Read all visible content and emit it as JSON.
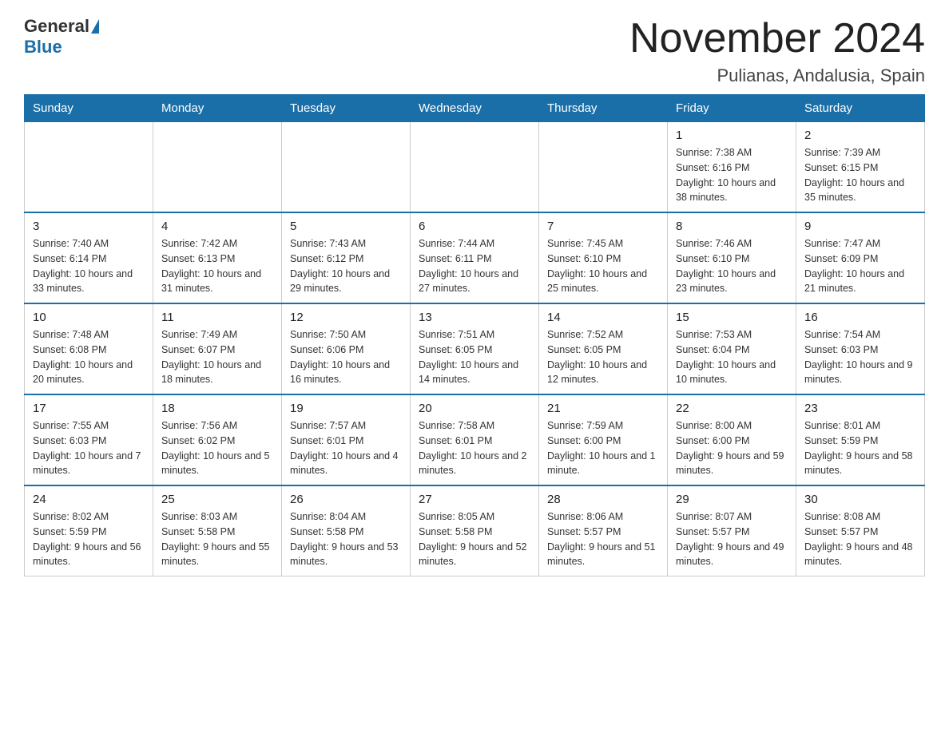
{
  "logo": {
    "general": "General",
    "blue": "Blue"
  },
  "title": "November 2024",
  "location": "Pulianas, Andalusia, Spain",
  "weekdays": [
    "Sunday",
    "Monday",
    "Tuesday",
    "Wednesday",
    "Thursday",
    "Friday",
    "Saturday"
  ],
  "weeks": [
    [
      {
        "day": "",
        "info": ""
      },
      {
        "day": "",
        "info": ""
      },
      {
        "day": "",
        "info": ""
      },
      {
        "day": "",
        "info": ""
      },
      {
        "day": "",
        "info": ""
      },
      {
        "day": "1",
        "info": "Sunrise: 7:38 AM\nSunset: 6:16 PM\nDaylight: 10 hours and 38 minutes."
      },
      {
        "day": "2",
        "info": "Sunrise: 7:39 AM\nSunset: 6:15 PM\nDaylight: 10 hours and 35 minutes."
      }
    ],
    [
      {
        "day": "3",
        "info": "Sunrise: 7:40 AM\nSunset: 6:14 PM\nDaylight: 10 hours and 33 minutes."
      },
      {
        "day": "4",
        "info": "Sunrise: 7:42 AM\nSunset: 6:13 PM\nDaylight: 10 hours and 31 minutes."
      },
      {
        "day": "5",
        "info": "Sunrise: 7:43 AM\nSunset: 6:12 PM\nDaylight: 10 hours and 29 minutes."
      },
      {
        "day": "6",
        "info": "Sunrise: 7:44 AM\nSunset: 6:11 PM\nDaylight: 10 hours and 27 minutes."
      },
      {
        "day": "7",
        "info": "Sunrise: 7:45 AM\nSunset: 6:10 PM\nDaylight: 10 hours and 25 minutes."
      },
      {
        "day": "8",
        "info": "Sunrise: 7:46 AM\nSunset: 6:10 PM\nDaylight: 10 hours and 23 minutes."
      },
      {
        "day": "9",
        "info": "Sunrise: 7:47 AM\nSunset: 6:09 PM\nDaylight: 10 hours and 21 minutes."
      }
    ],
    [
      {
        "day": "10",
        "info": "Sunrise: 7:48 AM\nSunset: 6:08 PM\nDaylight: 10 hours and 20 minutes."
      },
      {
        "day": "11",
        "info": "Sunrise: 7:49 AM\nSunset: 6:07 PM\nDaylight: 10 hours and 18 minutes."
      },
      {
        "day": "12",
        "info": "Sunrise: 7:50 AM\nSunset: 6:06 PM\nDaylight: 10 hours and 16 minutes."
      },
      {
        "day": "13",
        "info": "Sunrise: 7:51 AM\nSunset: 6:05 PM\nDaylight: 10 hours and 14 minutes."
      },
      {
        "day": "14",
        "info": "Sunrise: 7:52 AM\nSunset: 6:05 PM\nDaylight: 10 hours and 12 minutes."
      },
      {
        "day": "15",
        "info": "Sunrise: 7:53 AM\nSunset: 6:04 PM\nDaylight: 10 hours and 10 minutes."
      },
      {
        "day": "16",
        "info": "Sunrise: 7:54 AM\nSunset: 6:03 PM\nDaylight: 10 hours and 9 minutes."
      }
    ],
    [
      {
        "day": "17",
        "info": "Sunrise: 7:55 AM\nSunset: 6:03 PM\nDaylight: 10 hours and 7 minutes."
      },
      {
        "day": "18",
        "info": "Sunrise: 7:56 AM\nSunset: 6:02 PM\nDaylight: 10 hours and 5 minutes."
      },
      {
        "day": "19",
        "info": "Sunrise: 7:57 AM\nSunset: 6:01 PM\nDaylight: 10 hours and 4 minutes."
      },
      {
        "day": "20",
        "info": "Sunrise: 7:58 AM\nSunset: 6:01 PM\nDaylight: 10 hours and 2 minutes."
      },
      {
        "day": "21",
        "info": "Sunrise: 7:59 AM\nSunset: 6:00 PM\nDaylight: 10 hours and 1 minute."
      },
      {
        "day": "22",
        "info": "Sunrise: 8:00 AM\nSunset: 6:00 PM\nDaylight: 9 hours and 59 minutes."
      },
      {
        "day": "23",
        "info": "Sunrise: 8:01 AM\nSunset: 5:59 PM\nDaylight: 9 hours and 58 minutes."
      }
    ],
    [
      {
        "day": "24",
        "info": "Sunrise: 8:02 AM\nSunset: 5:59 PM\nDaylight: 9 hours and 56 minutes."
      },
      {
        "day": "25",
        "info": "Sunrise: 8:03 AM\nSunset: 5:58 PM\nDaylight: 9 hours and 55 minutes."
      },
      {
        "day": "26",
        "info": "Sunrise: 8:04 AM\nSunset: 5:58 PM\nDaylight: 9 hours and 53 minutes."
      },
      {
        "day": "27",
        "info": "Sunrise: 8:05 AM\nSunset: 5:58 PM\nDaylight: 9 hours and 52 minutes."
      },
      {
        "day": "28",
        "info": "Sunrise: 8:06 AM\nSunset: 5:57 PM\nDaylight: 9 hours and 51 minutes."
      },
      {
        "day": "29",
        "info": "Sunrise: 8:07 AM\nSunset: 5:57 PM\nDaylight: 9 hours and 49 minutes."
      },
      {
        "day": "30",
        "info": "Sunrise: 8:08 AM\nSunset: 5:57 PM\nDaylight: 9 hours and 48 minutes."
      }
    ]
  ]
}
